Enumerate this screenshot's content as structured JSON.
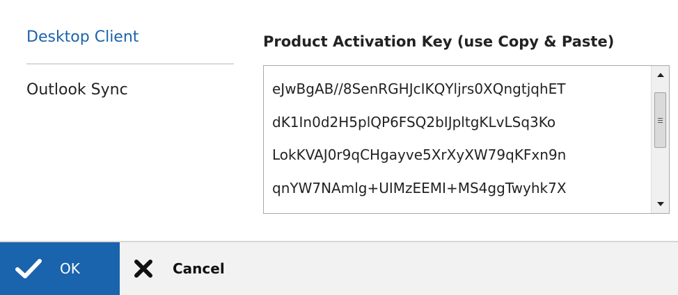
{
  "nav": {
    "items": [
      {
        "label": "Desktop Client",
        "active": true
      },
      {
        "label": "Outlook Sync",
        "active": false
      }
    ]
  },
  "key": {
    "label": "Product Activation Key (use Copy & Paste)",
    "lines": [
      "eJwBgAB//8SenRGHJcIKQYljrs0XQngtjqhET",
      "dK1In0d2H5plQP6FSQ2bIJpltgKLvLSq3Ko",
      "LokKVAJ0r9qCHgayve5XrXyXW79qKFxn9n",
      "qnYW7NAmlg+UIMzEEMI+MS4ggTwyhk7X"
    ]
  },
  "footer": {
    "ok_label": "OK",
    "cancel_label": "Cancel"
  },
  "icons": {
    "ok": "checkmark-icon",
    "cancel": "close-x-icon",
    "scroll_up": "arrow-up-icon",
    "scroll_down": "arrow-down-icon",
    "scroll_grip": "grip-icon"
  },
  "colors": {
    "accent": "#1a63ad",
    "footer_bg": "#f2f2f2",
    "text": "#222222"
  }
}
